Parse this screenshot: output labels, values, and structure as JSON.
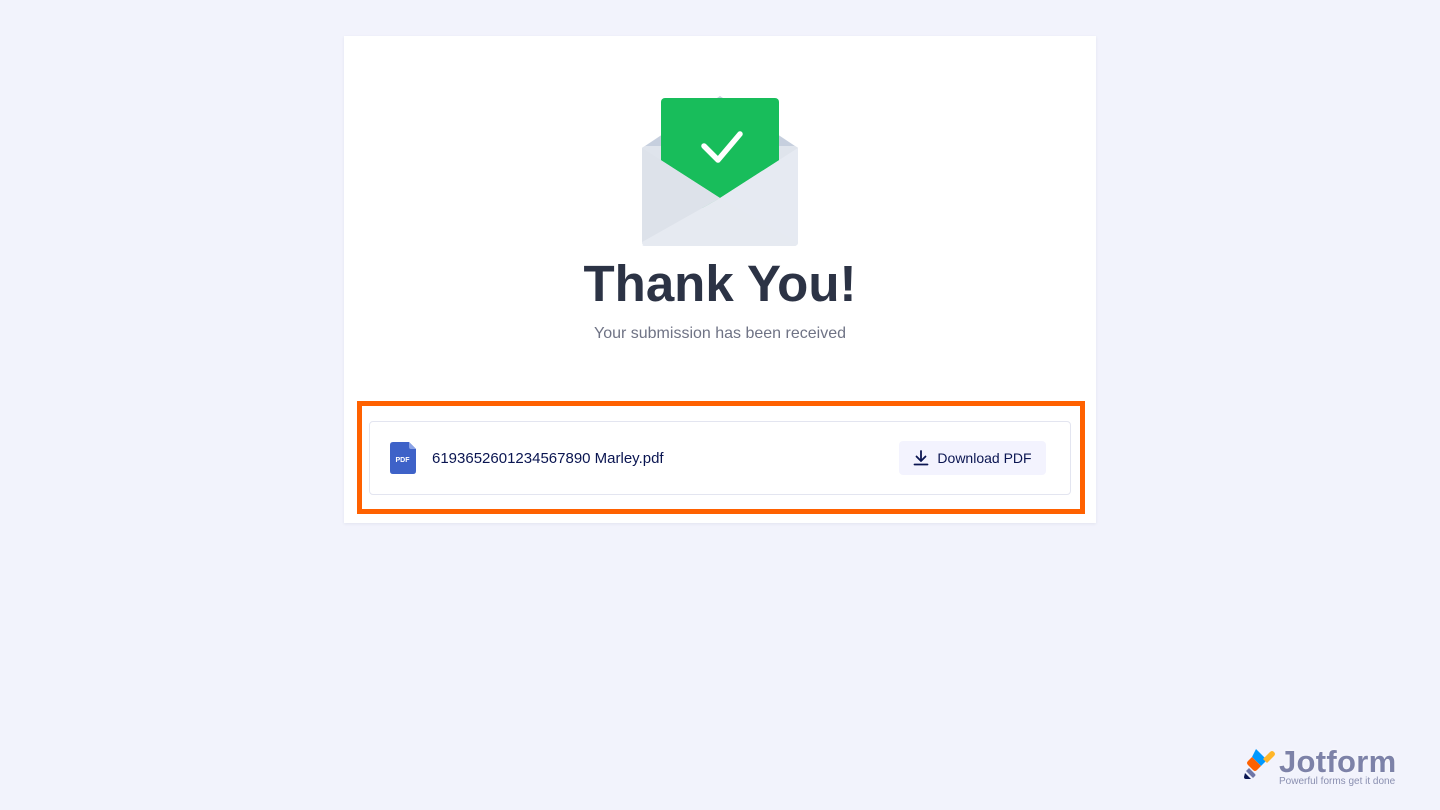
{
  "confirmation": {
    "title": "Thank You!",
    "subtitle": "Your submission has been received"
  },
  "attachment": {
    "file_badge": "PDF",
    "file_name": "6193652601234567890 Marley.pdf",
    "download_label": "Download PDF"
  },
  "branding": {
    "name": "Jotform",
    "tagline": "Powerful forms get it done"
  },
  "colors": {
    "page_background": "#f2f3fc",
    "card_background": "#ffffff",
    "success_green": "#18bd5b",
    "highlight_orange": "#ff6100",
    "pdf_icon_blue": "#3e62c8",
    "text_navy": "#0a1551",
    "title_dark": "#2c3345"
  },
  "icons": {
    "envelope": "envelope-check-icon",
    "file": "pdf-file-icon",
    "download": "download-icon",
    "brand": "jotform-logo-icon"
  }
}
